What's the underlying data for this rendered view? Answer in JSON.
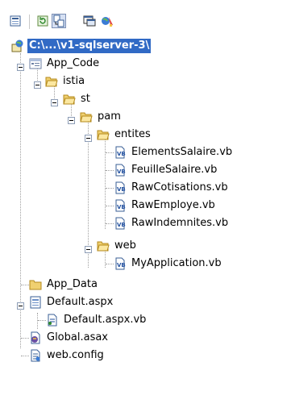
{
  "toolbar": {
    "buttons": [
      {
        "icon": "properties-icon"
      },
      {
        "icon": "refresh-icon"
      },
      {
        "icon": "nest-related-files-icon",
        "pressed": true
      },
      {
        "icon": "view-designer-icon"
      },
      {
        "icon": "asp-net-configuration-icon"
      }
    ]
  },
  "tree": {
    "root": {
      "label": "C:\\...\\v1-sqlserver-3\\"
    },
    "app_code": {
      "label": "App_Code"
    },
    "istia": {
      "label": "istia"
    },
    "st": {
      "label": "st"
    },
    "pam": {
      "label": "pam"
    },
    "entites": {
      "label": "entites"
    },
    "entites_files": [
      "ElementsSalaire.vb",
      "FeuilleSalaire.vb",
      "RawCotisations.vb",
      "RawEmploye.vb",
      "RawIndemnites.vb"
    ],
    "web": {
      "label": "web"
    },
    "web_files": [
      "MyApplication.vb"
    ],
    "app_data": {
      "label": "App_Data"
    },
    "default_aspx": {
      "label": "Default.aspx"
    },
    "default_aspx_vb": {
      "label": "Default.aspx.vb"
    },
    "global_asax": {
      "label": "Global.asax"
    },
    "web_config": {
      "label": "web.config"
    }
  }
}
